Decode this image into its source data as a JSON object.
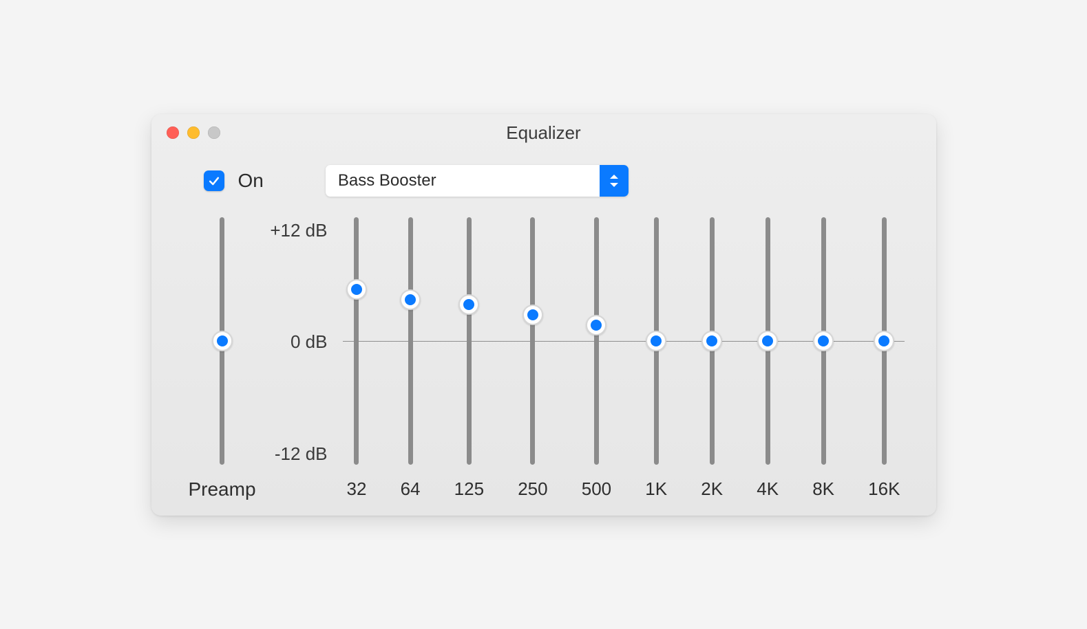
{
  "window": {
    "title": "Equalizer"
  },
  "controls": {
    "on_checked": true,
    "on_label": "On",
    "preset_selected": "Bass Booster"
  },
  "scale": {
    "max_label": "+12 dB",
    "zero_label": "0 dB",
    "min_label": "-12 dB",
    "max_db": 12,
    "min_db": -12
  },
  "preamp": {
    "label": "Preamp",
    "value_db": 0
  },
  "bands": [
    {
      "label": "32",
      "value_db": 5.0
    },
    {
      "label": "64",
      "value_db": 4.0
    },
    {
      "label": "125",
      "value_db": 3.5
    },
    {
      "label": "250",
      "value_db": 2.5
    },
    {
      "label": "500",
      "value_db": 1.5
    },
    {
      "label": "1K",
      "value_db": 0
    },
    {
      "label": "2K",
      "value_db": 0
    },
    {
      "label": "4K",
      "value_db": 0
    },
    {
      "label": "8K",
      "value_db": 0
    },
    {
      "label": "16K",
      "value_db": 0
    }
  ],
  "chart_data": {
    "type": "bar",
    "title": "Equalizer",
    "categories": [
      "32",
      "64",
      "125",
      "250",
      "500",
      "1K",
      "2K",
      "4K",
      "8K",
      "16K"
    ],
    "values": [
      5.0,
      4.0,
      3.5,
      2.5,
      1.5,
      0,
      0,
      0,
      0,
      0
    ],
    "ylabel": "dB",
    "ylim": [
      -12,
      12
    ]
  }
}
